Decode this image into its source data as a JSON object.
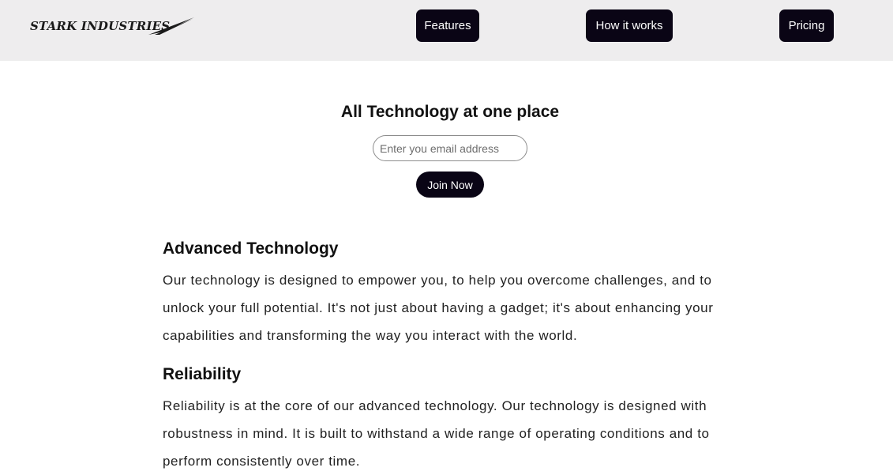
{
  "header": {
    "logo_text": "STARK INDUSTRIES",
    "nav": {
      "features_label": "Features",
      "how_label": "How it works",
      "pricing_label": "Pricing"
    }
  },
  "hero": {
    "title": "All Technology at one place",
    "email_placeholder": "Enter you email address",
    "join_label": "Join Now"
  },
  "sections": [
    {
      "heading": "Advanced Technology",
      "body": "Our technology is designed to empower you, to help you overcome challenges, and to unlock your full potential. It's not just about having a gadget; it's about enhancing your capabilities and transforming the way you interact with the world."
    },
    {
      "heading": "Reliability",
      "body": "Reliability is at the core of our advanced technology. Our technology is designed with robustness in mind. It is built to withstand a wide range of operating conditions and to perform consistently over time."
    }
  ],
  "colors": {
    "header_bg": "#eeedee",
    "button_bg": "#0a0515",
    "button_text": "#ffffff"
  }
}
